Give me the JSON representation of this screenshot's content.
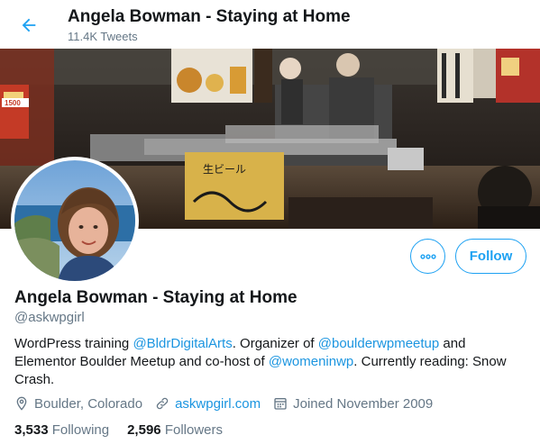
{
  "header": {
    "title": "Angela Bowman - Staying at Home",
    "tweet_count": "11.4K Tweets"
  },
  "banner": {
    "sign_left": "1500",
    "sign_right": "生ビール"
  },
  "profile": {
    "name": "Angela Bowman - Staying at Home",
    "handle": "@askwpgirl",
    "follow_label": "Follow",
    "bio": {
      "t1": "WordPress training ",
      "l1": "@BldrDigitalArts",
      "t2": ". Organizer of ",
      "l2": "@boulderwpmeetup",
      "t3": " and Elementor Boulder Meetup and co-host of ",
      "l3": "@womeninwp",
      "t4": ". Currently reading: Snow Crash."
    },
    "location": "Boulder, Colorado",
    "website": "askwpgirl.com",
    "joined": "Joined November 2009",
    "following_count": "3,533",
    "following_label": "Following",
    "followers_count": "2,596",
    "followers_label": "Followers"
  },
  "icons": {
    "back": "arrow-left-icon",
    "more": "more-horizontal-icon",
    "location": "map-pin-icon",
    "link": "link-icon",
    "calendar": "calendar-icon"
  },
  "colors": {
    "accent": "#1da1f2",
    "link": "#1b95e0",
    "secondary_text": "#657786",
    "primary_text": "#14171a"
  }
}
